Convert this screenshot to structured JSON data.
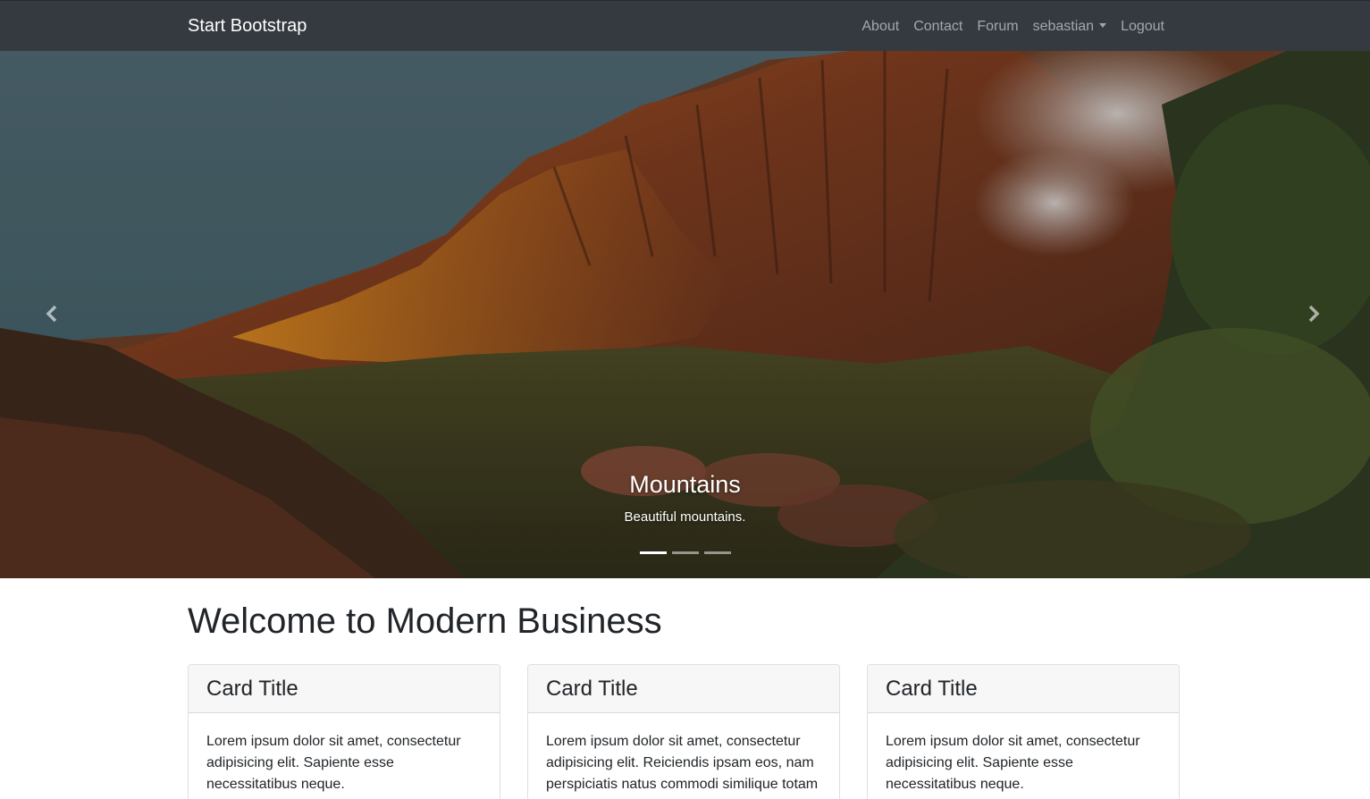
{
  "navbar": {
    "brand": "Start Bootstrap",
    "links": [
      {
        "label": "About"
      },
      {
        "label": "Contact"
      },
      {
        "label": "Forum"
      },
      {
        "label": "sebastian",
        "dropdown": true
      },
      {
        "label": "Logout"
      }
    ]
  },
  "carousel": {
    "slide": {
      "title": "Mountains",
      "text": "Beautiful mountains."
    },
    "indicator_count": 3,
    "active_index": 0,
    "controls": {
      "prev_icon": "chevron-left-icon",
      "next_icon": "chevron-right-icon"
    }
  },
  "main": {
    "heading": "Welcome to Modern Business",
    "cards": [
      {
        "title": "Card Title",
        "text": "Lorem ipsum dolor sit amet, consectetur adipisicing elit. Sapiente esse necessitatibus neque."
      },
      {
        "title": "Card Title",
        "text": "Lorem ipsum dolor sit amet, consectetur adipisicing elit. Reiciendis ipsam eos, nam perspiciatis natus commodi similique totam"
      },
      {
        "title": "Card Title",
        "text": "Lorem ipsum dolor sit amet, consectetur adipisicing elit. Sapiente esse necessitatibus neque."
      }
    ]
  },
  "colors": {
    "navbar_bg": "#343a40",
    "card_header_bg": "#f7f7f7",
    "text": "#212529"
  }
}
